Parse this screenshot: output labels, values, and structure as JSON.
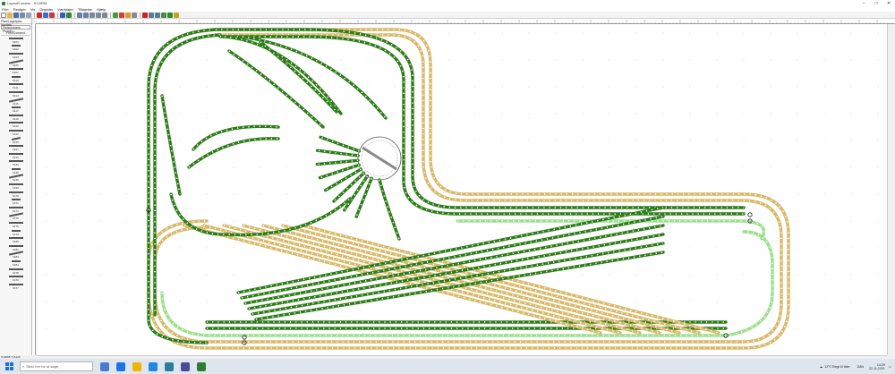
{
  "window": {
    "title": "Layout2.scarm - SCARM",
    "minimize": "–",
    "maximize": "□",
    "close": "✕"
  },
  "menu": [
    "Filer",
    "Redigér",
    "Vis",
    "Objekter",
    "Værktøjer",
    "Tilføjelse",
    "Hjælp"
  ],
  "left_panel": {
    "header": "Plan/Lagerplan Nordisk",
    "dropdown": "Fleischmann Piccolo",
    "group": "FlexiConnect",
    "items": [
      "9101",
      "9102",
      "9103",
      "9105",
      "9107",
      "9110",
      "9111",
      "9114",
      "9116",
      "9117",
      "9119",
      "9120",
      "9122",
      "9125",
      "9127",
      "9131",
      "9133",
      "9135",
      "9136",
      "9139",
      "9170",
      "9171",
      "9173",
      "9175",
      "9176",
      "9178",
      "9180",
      "9181",
      "9183",
      "9184",
      "9178",
      "9179",
      "9177"
    ]
  },
  "status": "X=2865 Y=1120",
  "taskbar": {
    "search_placeholder": "Skriv her for at søge",
    "weather": "12°C Regn til tider",
    "time": "14:29",
    "date": "22-11-2021",
    "lang": "DAN"
  },
  "colors": {
    "track_green": "#2e7d1a",
    "track_green_light": "#9ddf8f",
    "track_yellow": "#d9b96a",
    "sleeper": "#ffffff"
  }
}
